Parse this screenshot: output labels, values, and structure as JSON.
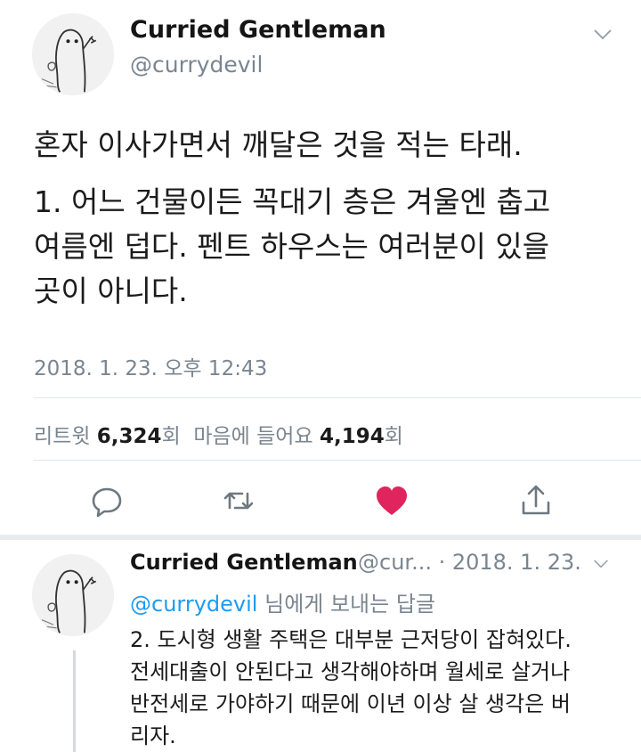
{
  "tweet": {
    "author_name": "Curried Gentleman",
    "author_handle": "@currydevil",
    "avatar_icon": "ghost-avatar-icon",
    "menu_icon": "chevron-down-icon",
    "text_lines": [
      "혼자 이사가면서 깨달은 것을 적는 타래.",
      "1. 어느 건물이든 꼭대기 층은 겨울엔 춥고",
      "여름엔 덥다. 펜트 하우스는 여러분이 있을",
      "곳이 아니다."
    ],
    "timestamp": "2018. 1. 23. 오후 12:43",
    "stats": {
      "retweet_label": "리트윗",
      "retweet_count": "6,324",
      "retweet_suffix": "회",
      "like_label": "마음에 들어요",
      "like_count": "4,194",
      "like_suffix": "회"
    },
    "actions": [
      {
        "name": "reply-icon"
      },
      {
        "name": "retweet-icon"
      },
      {
        "name": "heart-icon",
        "color": "#e0245e"
      },
      {
        "name": "share-icon"
      }
    ]
  },
  "reply": {
    "author_name": "Curried Gentleman",
    "meta": "@cur... · 2018. 1. 23.",
    "reply_to_handle": "@currydevil",
    "reply_to_suffix": "님에게 보내는 답글",
    "text_lines": [
      "2. 도시형 생활 주택은 대부분 근저당이 잡혀있다.",
      "전세대출이 안된다고 생각해야하며 월세로 살거나",
      "반전세로 가야하기 때문에 이년 이상 살 생각은 버",
      "리자."
    ]
  },
  "colors": {
    "link": "#1d9bf0",
    "muted": "#7a8590",
    "like": "#e0245e"
  }
}
